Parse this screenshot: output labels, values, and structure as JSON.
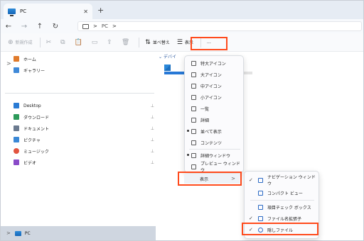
{
  "tab": {
    "title": "PC",
    "close": "✕",
    "new": "+"
  },
  "nav": {
    "back": "←",
    "forward": "→",
    "up": "↑",
    "refresh": "↻",
    "path_sep": ">",
    "location": "PC",
    "path_more": ">"
  },
  "toolbar": {
    "new_label": "新規作成",
    "sort_label": "並べ替え",
    "view_label": "表示",
    "more_label": "…"
  },
  "sidebar": {
    "home": "ホーム",
    "gallery": "ギャラリー",
    "expander": ">",
    "desktop": "Desktop",
    "downloads": "ダウンロード",
    "documents": "ドキュメント",
    "pictures": "ピクチャ",
    "music": "ミュージック",
    "videos": "ビデオ",
    "pc": "PC",
    "pin": "📌"
  },
  "content": {
    "section_label": "デバイ"
  },
  "view_menu": {
    "items": [
      "特大アイコン",
      "大アイコン",
      "中アイコン",
      "小アイコン",
      "一覧",
      "詳細",
      "並べて表示",
      "コンテンツ",
      "詳細ウィンドウ",
      "プレビュー ウィンドウ",
      "表示"
    ],
    "arrow": ">"
  },
  "show_submenu": {
    "items": [
      "ナビゲーション ウィンドウ",
      "コンパクト ビュー",
      "項目チェック ボックス",
      "ファイル名拡張子",
      "隠しファイル"
    ],
    "check": "✓"
  },
  "colors": {
    "highlight": "#ff4a1c",
    "accent": "#2778d6"
  }
}
